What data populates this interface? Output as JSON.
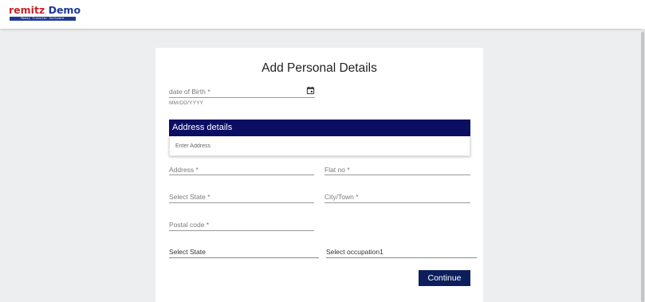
{
  "brand": {
    "name_part1": "remitz",
    "name_part2": "Demo",
    "tagline": "Money Transfer Software",
    "colors": {
      "primary": "#1f3a93",
      "accent": "#c1272d"
    }
  },
  "form": {
    "title": "Add Personal Details",
    "dob": {
      "label": "date of Birth *",
      "hint": "MM/DD/YYYY",
      "icon": "calendar-icon"
    },
    "address_section": {
      "title": "Address details",
      "search_placeholder": "Enter Address",
      "header_color": "#0b0e62"
    },
    "fields": {
      "address": "Address *",
      "flat_no": "Flat no *",
      "select_state_required": "Select State *",
      "city": "City/Town *",
      "postal_code": "Postal code *",
      "select_state": "Select State",
      "occupation": "Select occupation1"
    },
    "continue_label": "Continue",
    "button_color": "#0c1f5c"
  }
}
